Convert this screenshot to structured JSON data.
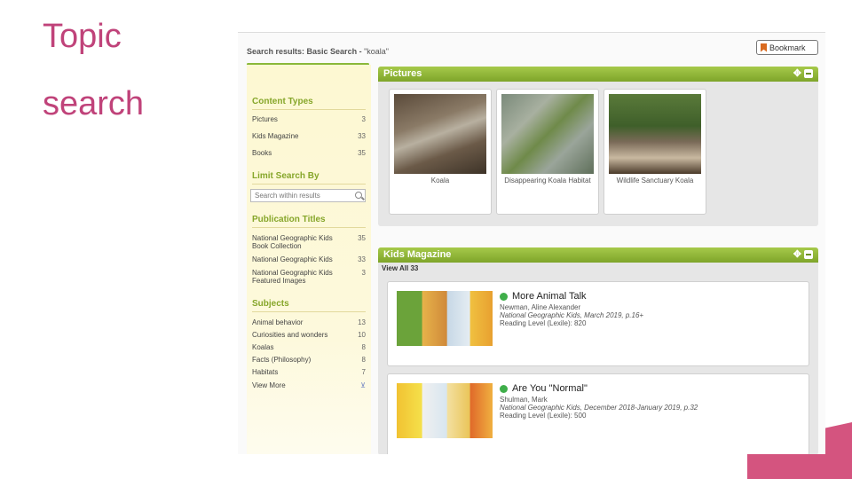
{
  "slide": {
    "title_line1": "Topic",
    "title_line2": "search"
  },
  "header": {
    "results_prefix": "Search results: Basic Search - ",
    "query": "\"koala\"",
    "bookmark_label": "Bookmark"
  },
  "sidebar": {
    "content_types_heading": "Content Types",
    "content_types": [
      {
        "label": "Pictures",
        "count": "3"
      },
      {
        "label": "Kids Magazine",
        "count": "33"
      },
      {
        "label": "Books",
        "count": "35"
      }
    ],
    "limit_heading": "Limit Search By",
    "search_placeholder": "Search within results",
    "publication_heading": "Publication Titles",
    "publications": [
      {
        "label": "National Geographic Kids Book Collection",
        "count": "35"
      },
      {
        "label": "National Geographic Kids",
        "count": "33"
      },
      {
        "label": "National Geographic Kids Featured Images",
        "count": "3"
      }
    ],
    "subjects_heading": "Subjects",
    "subjects": [
      {
        "label": "Animal behavior",
        "count": "13"
      },
      {
        "label": "Curiosities and wonders",
        "count": "10"
      },
      {
        "label": "Koalas",
        "count": "8"
      },
      {
        "label": "Facts (Philosophy)",
        "count": "8"
      },
      {
        "label": "Habitats",
        "count": "7"
      }
    ],
    "view_more_label": "View More"
  },
  "pictures_panel": {
    "title": "Pictures",
    "items": [
      {
        "caption": "Koala"
      },
      {
        "caption": "Disappearing Koala Habitat"
      },
      {
        "caption": "Wildlife Sanctuary Koala"
      }
    ]
  },
  "kids_panel": {
    "title": "Kids Magazine",
    "view_all": "View All 33",
    "articles": [
      {
        "title": "More Animal Talk",
        "author": "Newman, Aline Alexander",
        "source": "National Geographic Kids, March 2019, p.16+",
        "reading_level": "Reading Level (Lexile): 820"
      },
      {
        "title": "Are You \"Normal\"",
        "author": "Shulman, Mark",
        "source": "National Geographic Kids, December 2018-January 2019, p.32",
        "reading_level": "Reading Level (Lexile): 500"
      }
    ]
  },
  "colors": {
    "slide_title": "#c0437a",
    "accent_green": "#8ab83a",
    "deco_pink": "#d4547f"
  }
}
